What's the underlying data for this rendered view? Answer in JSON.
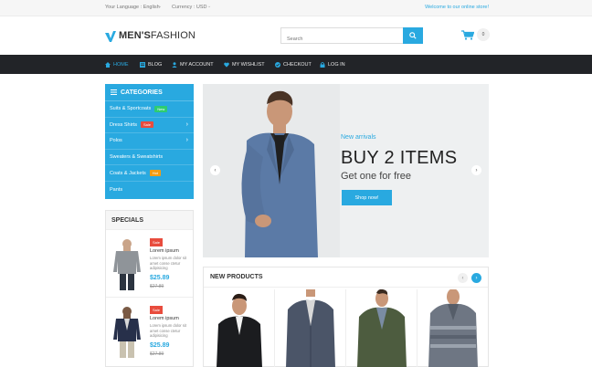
{
  "topbar": {
    "language_label": "Your Language : English",
    "currency_label": "Currency : USD",
    "welcome": "Welcome to our online store!"
  },
  "header": {
    "logo_bold": "MEN'S",
    "logo_light": "FASHION",
    "search_placeholder": "Search",
    "cart_count": "0"
  },
  "nav": {
    "items": [
      {
        "label": "Home",
        "icon": "home-icon",
        "active": true
      },
      {
        "label": "Blog",
        "icon": "blog-icon"
      },
      {
        "label": "My Account",
        "icon": "user-icon"
      },
      {
        "label": "My Wishlist",
        "icon": "heart-icon"
      },
      {
        "label": "Checkout",
        "icon": "check-icon"
      },
      {
        "label": "Log In",
        "icon": "lock-icon"
      }
    ]
  },
  "categories": {
    "title": "CATEGORIES",
    "items": [
      {
        "label": "Suits & Sportcoats",
        "badge": "New",
        "badge_color": "#2ecc71"
      },
      {
        "label": "Dress Shirts",
        "badge": "Sale",
        "badge_color": "#e84c3d",
        "arrow": true
      },
      {
        "label": "Polos",
        "arrow": true
      },
      {
        "label": "Sweaters & Sweatshirts"
      },
      {
        "label": "Coats & Jackets",
        "badge": "Hot",
        "badge_color": "#f39c12"
      },
      {
        "label": "Pants"
      }
    ]
  },
  "specials": {
    "title": "SPECIALS",
    "items": [
      {
        "sale": "Sale",
        "name": "Lorem ipsum",
        "desc": "Lorem ipsum dolor sit amet conse ctetur adipisicing",
        "price": "$25.89",
        "old_price": "$27.89"
      },
      {
        "sale": "Sale",
        "name": "Lorem ipsum",
        "desc": "Lorem ipsum dolor sit amet conse ctetur adipisicing",
        "price": "$25.89",
        "old_price": "$27.89"
      }
    ]
  },
  "hero": {
    "tagline": "New arrivals",
    "headline": "BUY 2 ITEMS",
    "subline": "Get one for free",
    "button": "Shop now!"
  },
  "new_products": {
    "title": "NEW PRODUCTS"
  },
  "colors": {
    "accent": "#29a9e0",
    "nav_bg": "#222428",
    "sale": "#e84c3d"
  }
}
